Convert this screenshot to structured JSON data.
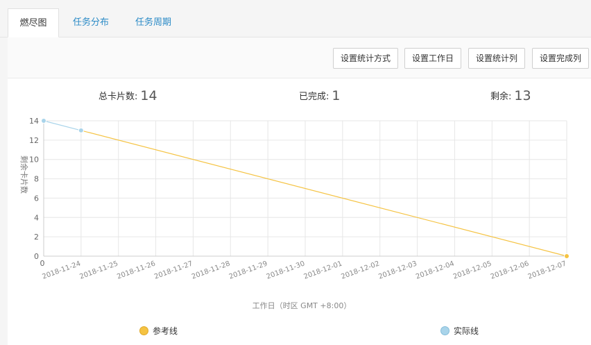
{
  "tabs": [
    {
      "label": "燃尽图",
      "active": true
    },
    {
      "label": "任务分布",
      "active": false
    },
    {
      "label": "任务周期",
      "active": false
    }
  ],
  "toolbar": {
    "buttons": [
      "设置统计方式",
      "设置工作日",
      "设置统计列",
      "设置完成列"
    ]
  },
  "stats": {
    "total_label": "总卡片数:",
    "total_value": "14",
    "done_label": "已完成:",
    "done_value": "1",
    "remaining_label": "剩余:",
    "remaining_value": "13"
  },
  "chart_data": {
    "type": "line",
    "xlabel": "工作日（时区 GMT +8:00）",
    "ylabel": "剩余卡片数",
    "x_zero_label": "0",
    "categories": [
      "2018-11-24",
      "2018-11-25",
      "2018-11-26",
      "2018-11-27",
      "2018-11-28",
      "2018-11-29",
      "2018-11-30",
      "2018-12-01",
      "2018-12-02",
      "2018-12-03",
      "2018-12-04",
      "2018-12-05",
      "2018-12-06",
      "2018-12-07"
    ],
    "yticks": [
      0,
      2,
      4,
      6,
      8,
      10,
      12,
      14
    ],
    "ylim": [
      0,
      14
    ],
    "grid": true,
    "legend_position": "bottom",
    "series": [
      {
        "name": "参考线",
        "color": "#f5c342",
        "points": [
          [
            1,
            13
          ],
          [
            14,
            0
          ]
        ]
      },
      {
        "name": "实际线",
        "color": "#a9d4ea",
        "points": [
          [
            0,
            14
          ],
          [
            1,
            13
          ]
        ]
      }
    ]
  }
}
